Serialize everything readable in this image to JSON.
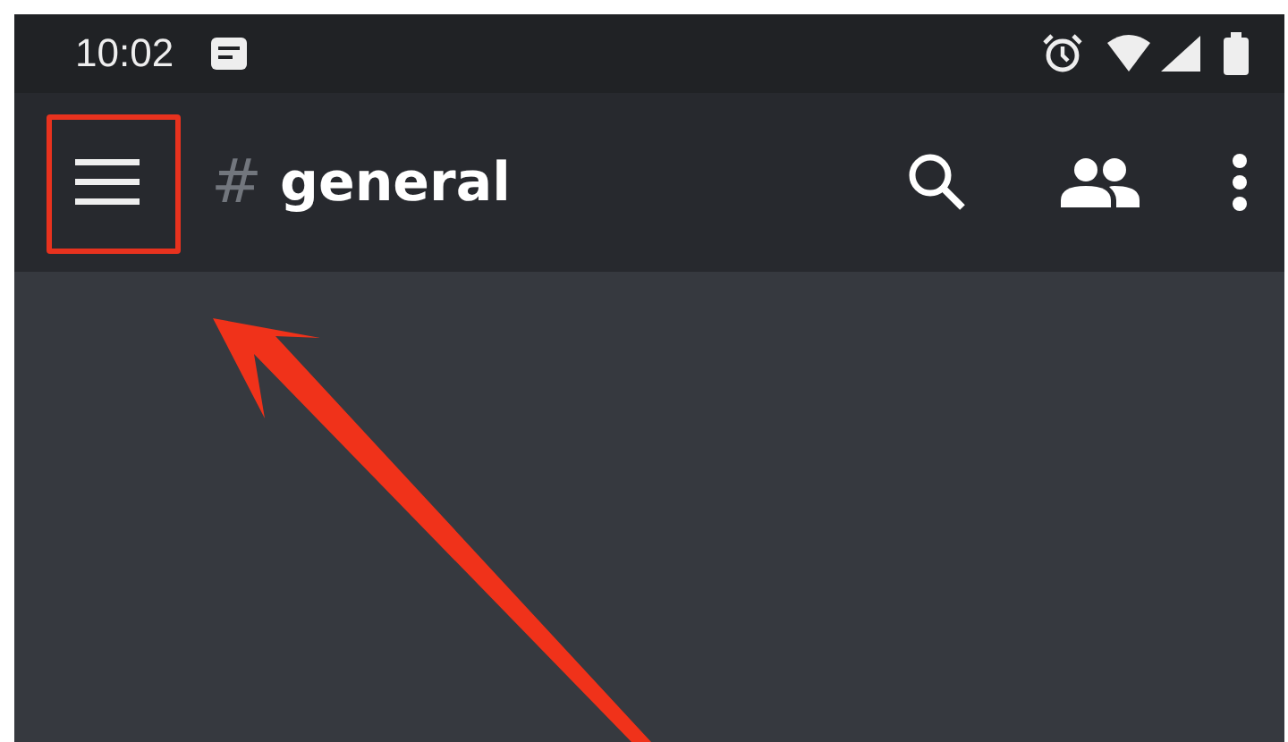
{
  "status_bar": {
    "time": "10:02"
  },
  "toolbar": {
    "channel_prefix": "#",
    "channel_name": "general"
  }
}
